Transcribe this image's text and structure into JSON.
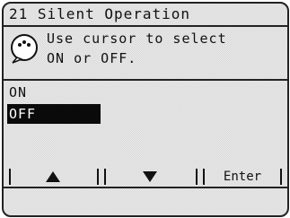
{
  "title": {
    "number": "21",
    "text": "Silent Operation"
  },
  "message": {
    "icon": "info-bubble-icon",
    "line1": "Use cursor to select",
    "line2": "ON or OFF."
  },
  "options": [
    {
      "label": "ON",
      "selected": false
    },
    {
      "label": "OFF",
      "selected": true
    }
  ],
  "softkeys": {
    "up_icon": "up-arrow-icon",
    "down_icon": "down-arrow-icon",
    "enter_label": "Enter"
  }
}
